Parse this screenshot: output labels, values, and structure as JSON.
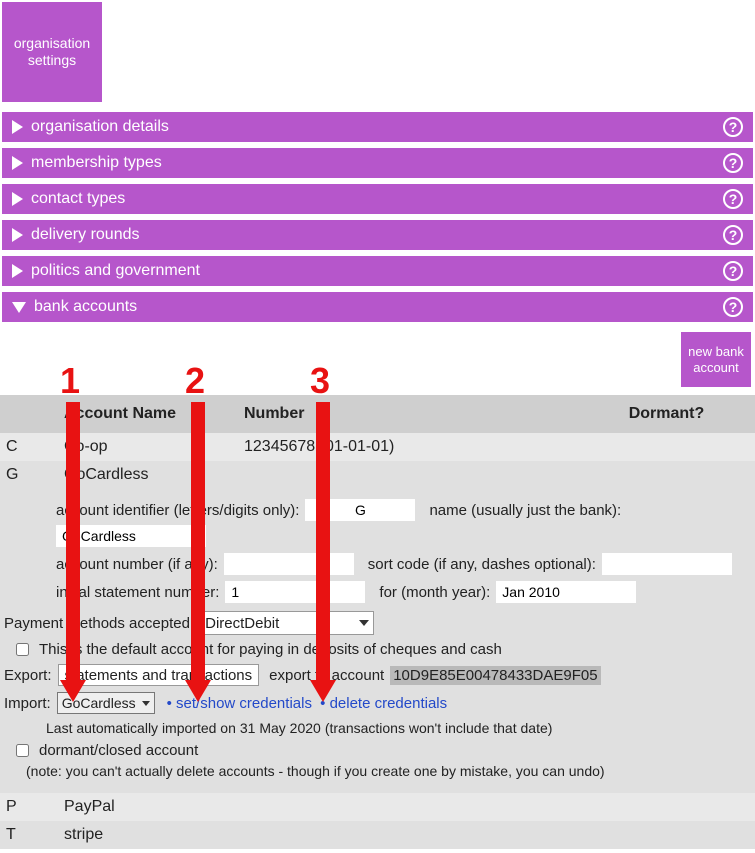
{
  "tile": {
    "line1": "organisation",
    "line2": "settings"
  },
  "sections": {
    "org": "organisation details",
    "mem": "membership types",
    "con": "contact types",
    "del": "delivery rounds",
    "pol": "politics and government",
    "bank": "bank accounts"
  },
  "new_button": {
    "line1": "new bank",
    "line2": "account"
  },
  "headers": {
    "name": "Account Name",
    "number": "Number",
    "dormant": "Dormant?"
  },
  "rows": [
    {
      "id": "C",
      "name": "Co-op",
      "number": "12345678 (01-01-01)"
    },
    {
      "id": "G",
      "name": "GoCardless",
      "number": ""
    },
    {
      "id": "P",
      "name": "PayPal",
      "number": ""
    },
    {
      "id": "T",
      "name": "stripe",
      "number": ""
    }
  ],
  "detail": {
    "labels": {
      "acct_id": "account identifier (letters/digits only):",
      "name": "name (usually just the bank):",
      "acct_no": "account number (if any):",
      "sort": "sort code (if any, dashes optional):",
      "init_stmt": "initial statement number:",
      "for": "for (month year):",
      "pay_methods": "Payment methods accepted:",
      "default_acct": "This is the default account for paying in deposits of cheques and cash",
      "export": "Export:",
      "export_to": "export to account",
      "import": "Import:",
      "set_creds": "set/show credentials",
      "del_creds": "delete credentials",
      "last_import_pre": "Last automatically imported on ",
      "last_import_date": "31 May 2020",
      "last_import_post": " (transactions won't include that date)",
      "dormant": "dormant/closed account",
      "dormant_note": "(note: you can't actually delete accounts - though if you create one by mistake, you can undo)",
      "export_type": "statements and transactions"
    },
    "values": {
      "acct_id": "G",
      "name": "GoCardless",
      "acct_no": "",
      "sort": "",
      "init_stmt": "1",
      "for": "Jan 2010",
      "pay_methods": "DirectDebit",
      "export_acct": "10D9E85E00478433DAE9F05",
      "import_src": "GoCardless"
    }
  },
  "anno": {
    "n1": "1",
    "n2": "2",
    "n3": "3"
  }
}
